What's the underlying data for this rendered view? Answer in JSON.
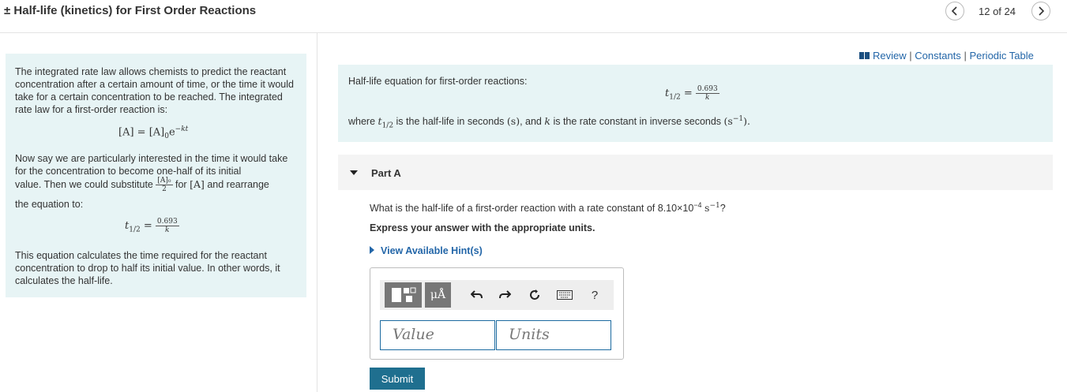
{
  "header": {
    "title": "± Half-life (kinetics) for First Order Reactions",
    "page_count": "12 of 24"
  },
  "intro": {
    "para1": "The integrated rate law allows chemists to predict the reactant concentration after a certain amount of time, or the time it would take for a certain concentration to be reached. The integrated rate law for a first-order reaction is:",
    "eq1": {
      "lhs": "[A] = [A]",
      "sub": "0",
      "e": "e",
      "exp": "−kt"
    },
    "para2_a": "Now say we are particularly interested in the time it would take for the concentration to become one-half of its initial",
    "para2_b_pre": "value. Then we could substitute",
    "para2_frac_num": "[A]₀",
    "para2_frac_den": "2",
    "para2_b_mid": "for",
    "para2_b_sym": "[A]",
    "para2_b_post": "and rearrange",
    "para2_c": "the equation to:",
    "eq2": {
      "lhs": "t",
      "sub": "1/2",
      "eqsign": "=",
      "num": "0.693",
      "den": "k"
    },
    "para3": "This equation calculates the time required for the reactant concentration to drop to half its initial value. In other words, it calculates the half-life."
  },
  "links": {
    "review": "Review",
    "constants": "Constants",
    "periodic": "Periodic Table",
    "sep": "|"
  },
  "info": {
    "label": "Half-life equation for first-order reactions:",
    "eq": {
      "lhs": "t",
      "sub": "1/2",
      "eqsign": "=",
      "num": "0.693",
      "den": "k"
    },
    "where_1": "where",
    "where_t": "t",
    "where_sub": "1/2",
    "where_2": "is the half-life in seconds",
    "where_s": "(s)",
    "where_3": ", and",
    "where_k": "k",
    "where_4": "is the rate constant in inverse seconds",
    "where_unit": "(s",
    "where_unit_exp": "−1",
    "where_unit_close": ")."
  },
  "partA": {
    "label": "Part A",
    "question_pre": "What is the half-life of a first-order reaction with a rate constant of 8.10×10",
    "question_exp": "−4",
    "question_unit": "s",
    "question_unit_exp": "−1",
    "question_post": "?",
    "instruction": "Express your answer with the appropriate units.",
    "hints": "View Available Hint(s)"
  },
  "answer": {
    "units_btn": "μÅ",
    "help": "?",
    "value_placeholder": "Value",
    "units_placeholder": "Units",
    "submit": "Submit"
  },
  "colors": {
    "accent": "#2366a8",
    "panel_bg": "#e7f4f5",
    "submit_bg": "#1f6f8f"
  }
}
